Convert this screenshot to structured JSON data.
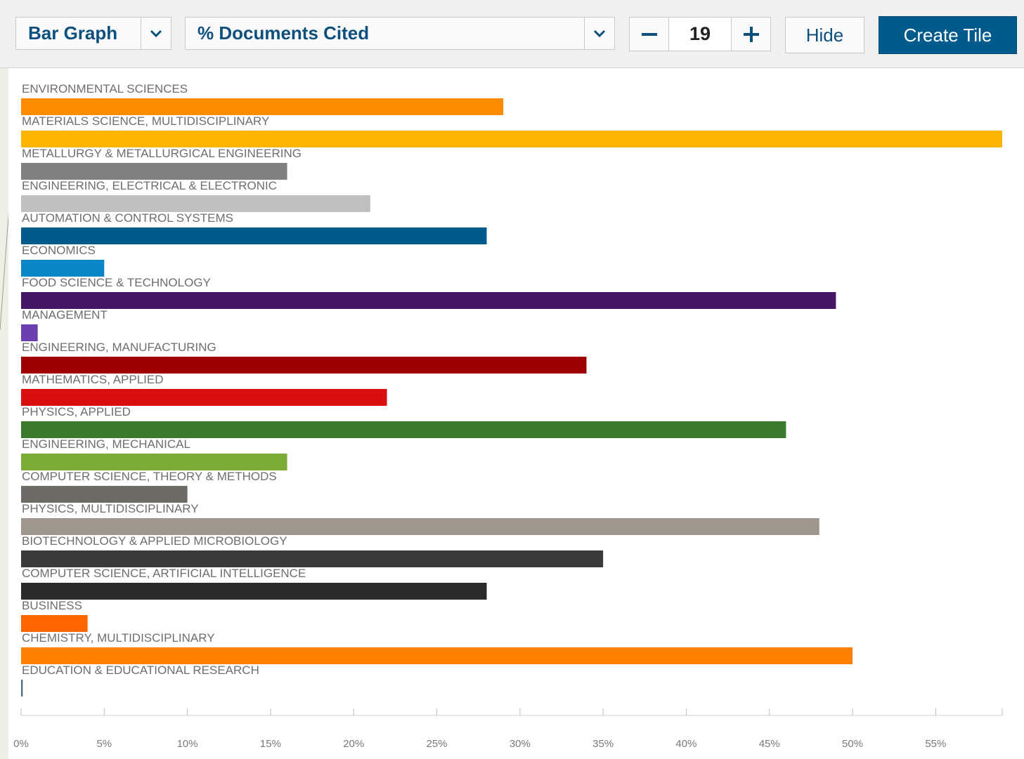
{
  "toolbar": {
    "chart_type": "Bar Graph",
    "metric": "% Documents Cited",
    "count": "19",
    "hide_label": "Hide",
    "create_label": "Create Tile",
    "icons": {
      "chart_type_dropdown": "chevron-down-icon",
      "metric_dropdown": "chevron-down-icon",
      "decrement": "minus-icon",
      "increment": "plus-icon"
    },
    "colors": {
      "accent": "#0d4f7d",
      "primary_button": "#005a8c"
    }
  },
  "chart_data": {
    "type": "bar",
    "orientation": "horizontal",
    "categories": [
      "ENVIRONMENTAL SCIENCES",
      "MATERIALS SCIENCE, MULTIDISCIPLINARY",
      "METALLURGY & METALLURGICAL ENGINEERING",
      "ENGINEERING, ELECTRICAL & ELECTRONIC",
      "AUTOMATION & CONTROL SYSTEMS",
      "ECONOMICS",
      "FOOD SCIENCE & TECHNOLOGY",
      "MANAGEMENT",
      "ENGINEERING, MANUFACTURING",
      "MATHEMATICS, APPLIED",
      "PHYSICS, APPLIED",
      "ENGINEERING, MECHANICAL",
      "COMPUTER SCIENCE, THEORY & METHODS",
      "PHYSICS, MULTIDISCIPLINARY",
      "BIOTECHNOLOGY & APPLIED MICROBIOLOGY",
      "COMPUTER SCIENCE, ARTIFICIAL INTELLIGENCE",
      "BUSINESS",
      "CHEMISTRY, MULTIDISCIPLINARY",
      "EDUCATION & EDUCATIONAL RESEARCH"
    ],
    "values": [
      29,
      59,
      16,
      21,
      28,
      5,
      49,
      1,
      34,
      22,
      46,
      16,
      10,
      48,
      35,
      28,
      4,
      50,
      0.1
    ],
    "colors": [
      "#ff8c00",
      "#ffb400",
      "#808080",
      "#c0c0c0",
      "#005a8c",
      "#0a86c8",
      "#461566",
      "#6b3fae",
      "#9e0000",
      "#d90f0f",
      "#3a7a2e",
      "#7cac38",
      "#6e6a66",
      "#9e968c",
      "#3b3b3b",
      "#2a2a2a",
      "#ff6600",
      "#ff7f00",
      "#4a6d8c"
    ],
    "xlim": [
      0,
      59
    ],
    "xticks": [
      0,
      5,
      10,
      15,
      20,
      25,
      30,
      35,
      40,
      45,
      50,
      55
    ],
    "xtick_labels": [
      "0%",
      "5%",
      "10%",
      "15%",
      "20%",
      "25%",
      "30%",
      "35%",
      "40%",
      "45%",
      "50%",
      "55%"
    ],
    "grid": false,
    "legend": "none"
  }
}
